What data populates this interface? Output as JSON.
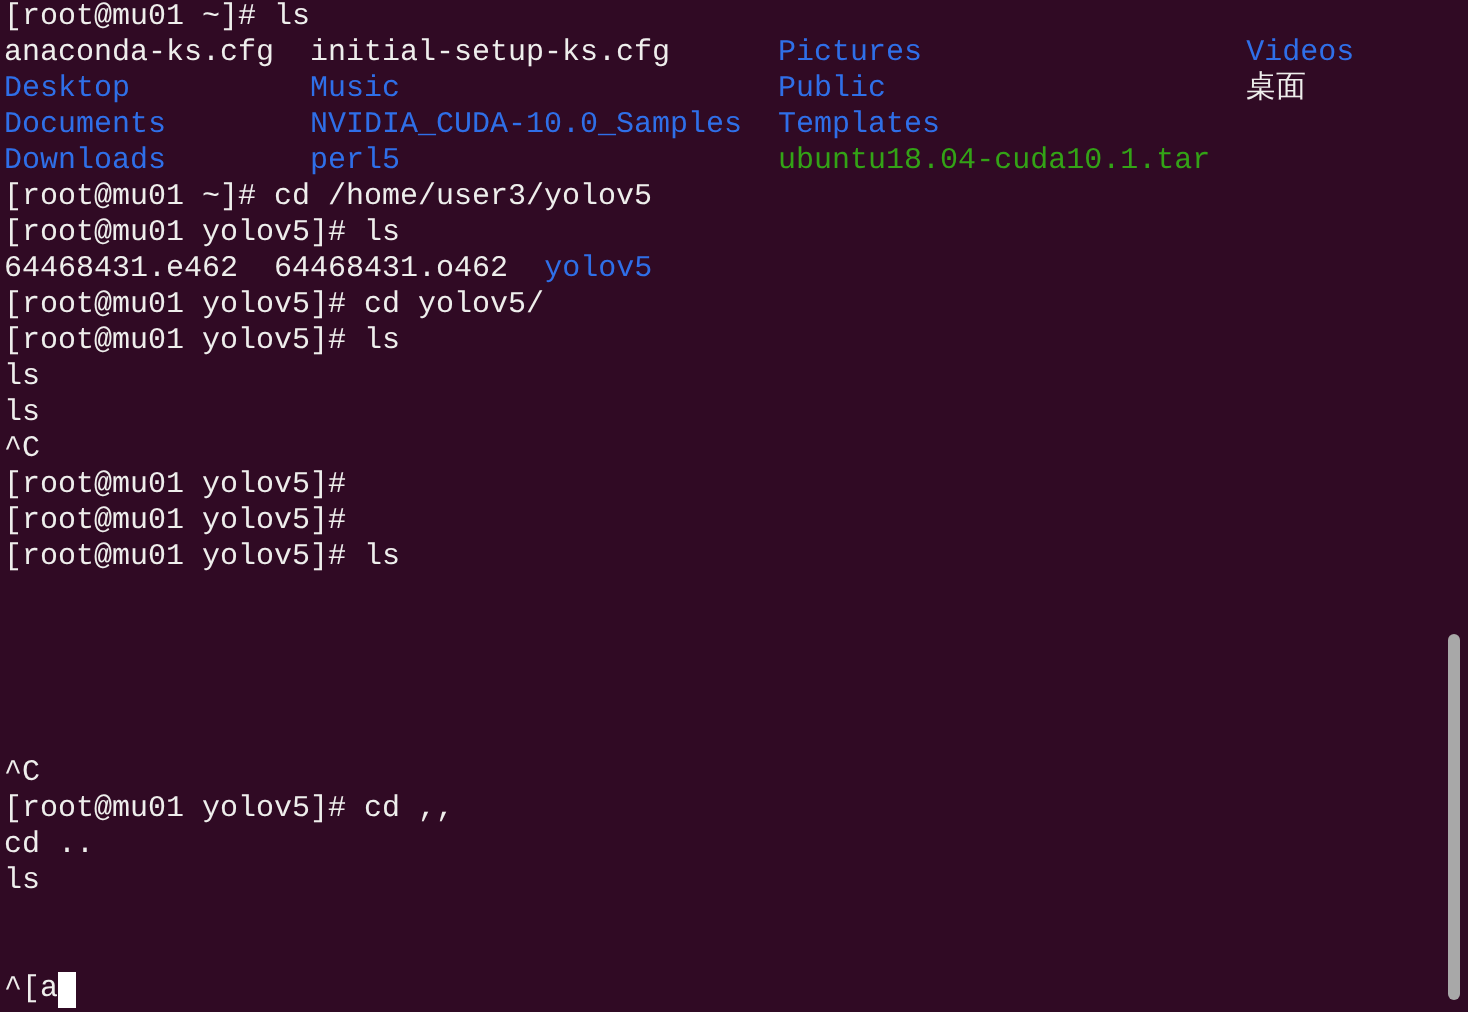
{
  "terminal": {
    "lines": [
      {
        "kind": "text",
        "segments": [
          {
            "text": "[root@mu01 ~]# ls",
            "kind": "plain"
          }
        ]
      },
      {
        "kind": "listing",
        "segments": [
          {
            "text": "anaconda-ks.cfg",
            "kind": "plain"
          },
          {
            "text": "initial-setup-ks.cfg",
            "kind": "plain"
          },
          {
            "text": "Pictures",
            "kind": "dir"
          },
          {
            "text": "Videos",
            "kind": "dir"
          }
        ]
      },
      {
        "kind": "listing",
        "segments": [
          {
            "text": "Desktop",
            "kind": "dir"
          },
          {
            "text": "Music",
            "kind": "dir"
          },
          {
            "text": "Public",
            "kind": "dir"
          },
          {
            "text": "桌面",
            "kind": "plain"
          }
        ]
      },
      {
        "kind": "listing",
        "segments": [
          {
            "text": "Documents",
            "kind": "dir"
          },
          {
            "text": "NVIDIA_CUDA-10.0_Samples",
            "kind": "dir"
          },
          {
            "text": "Templates",
            "kind": "dir"
          }
        ]
      },
      {
        "kind": "listing",
        "segments": [
          {
            "text": "Downloads",
            "kind": "dir"
          },
          {
            "text": "perl5",
            "kind": "dir"
          },
          {
            "text": "ubuntu18.04-cuda10.1.tar",
            "kind": "archive"
          }
        ]
      },
      {
        "kind": "text",
        "segments": [
          {
            "text": "[root@mu01 ~]# cd /home/user3/yolov5",
            "kind": "plain"
          }
        ]
      },
      {
        "kind": "text",
        "segments": [
          {
            "text": "[root@mu01 yolov5]# ls",
            "kind": "plain"
          }
        ]
      },
      {
        "kind": "text",
        "segments": [
          {
            "text": "64468431.e462",
            "kind": "plain"
          },
          {
            "text": "64468431.o462",
            "kind": "plain"
          },
          {
            "text": "yolov5",
            "kind": "dir"
          }
        ]
      },
      {
        "kind": "text",
        "segments": [
          {
            "text": "[root@mu01 yolov5]# cd yolov5/",
            "kind": "plain"
          }
        ]
      },
      {
        "kind": "text",
        "segments": [
          {
            "text": "[root@mu01 yolov5]# ls",
            "kind": "plain"
          }
        ]
      },
      {
        "kind": "text",
        "segments": [
          {
            "text": "ls",
            "kind": "plain"
          }
        ]
      },
      {
        "kind": "text",
        "segments": [
          {
            "text": "ls",
            "kind": "plain"
          }
        ]
      },
      {
        "kind": "text",
        "segments": [
          {
            "text": "^C",
            "kind": "plain"
          }
        ]
      },
      {
        "kind": "text",
        "segments": [
          {
            "text": "[root@mu01 yolov5]#",
            "kind": "plain"
          }
        ]
      },
      {
        "kind": "text",
        "segments": [
          {
            "text": "[root@mu01 yolov5]#",
            "kind": "plain"
          }
        ]
      },
      {
        "kind": "text",
        "segments": [
          {
            "text": "[root@mu01 yolov5]# ls",
            "kind": "plain"
          }
        ]
      },
      {
        "kind": "blank"
      },
      {
        "kind": "blank"
      },
      {
        "kind": "blank"
      },
      {
        "kind": "blank"
      },
      {
        "kind": "blank"
      },
      {
        "kind": "text",
        "segments": [
          {
            "text": "^C",
            "kind": "plain"
          }
        ]
      },
      {
        "kind": "text",
        "segments": [
          {
            "text": "[root@mu01 yolov5]# cd ,,",
            "kind": "plain"
          }
        ]
      },
      {
        "kind": "text",
        "segments": [
          {
            "text": "cd ..",
            "kind": "plain"
          }
        ]
      },
      {
        "kind": "text",
        "segments": [
          {
            "text": "ls",
            "kind": "plain"
          }
        ]
      },
      {
        "kind": "blank"
      },
      {
        "kind": "blank"
      },
      {
        "kind": "text",
        "segments": [
          {
            "text": "^[a",
            "kind": "plain"
          }
        ],
        "cursor": true
      }
    ]
  }
}
